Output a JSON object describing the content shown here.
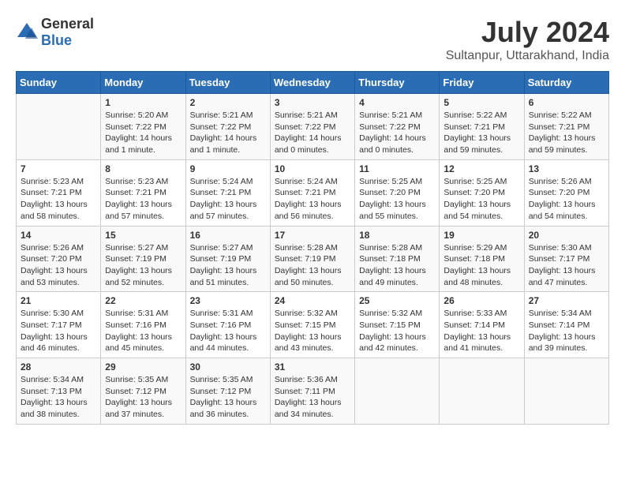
{
  "logo": {
    "general": "General",
    "blue": "Blue"
  },
  "title": "July 2024",
  "subtitle": "Sultanpur, Uttarakhand, India",
  "headers": [
    "Sunday",
    "Monday",
    "Tuesday",
    "Wednesday",
    "Thursday",
    "Friday",
    "Saturday"
  ],
  "weeks": [
    [
      {
        "date": "",
        "info": ""
      },
      {
        "date": "1",
        "info": "Sunrise: 5:20 AM\nSunset: 7:22 PM\nDaylight: 14 hours\nand 1 minute."
      },
      {
        "date": "2",
        "info": "Sunrise: 5:21 AM\nSunset: 7:22 PM\nDaylight: 14 hours\nand 1 minute."
      },
      {
        "date": "3",
        "info": "Sunrise: 5:21 AM\nSunset: 7:22 PM\nDaylight: 14 hours\nand 0 minutes."
      },
      {
        "date": "4",
        "info": "Sunrise: 5:21 AM\nSunset: 7:22 PM\nDaylight: 14 hours\nand 0 minutes."
      },
      {
        "date": "5",
        "info": "Sunrise: 5:22 AM\nSunset: 7:21 PM\nDaylight: 13 hours\nand 59 minutes."
      },
      {
        "date": "6",
        "info": "Sunrise: 5:22 AM\nSunset: 7:21 PM\nDaylight: 13 hours\nand 59 minutes."
      }
    ],
    [
      {
        "date": "7",
        "info": "Sunrise: 5:23 AM\nSunset: 7:21 PM\nDaylight: 13 hours\nand 58 minutes."
      },
      {
        "date": "8",
        "info": "Sunrise: 5:23 AM\nSunset: 7:21 PM\nDaylight: 13 hours\nand 57 minutes."
      },
      {
        "date": "9",
        "info": "Sunrise: 5:24 AM\nSunset: 7:21 PM\nDaylight: 13 hours\nand 57 minutes."
      },
      {
        "date": "10",
        "info": "Sunrise: 5:24 AM\nSunset: 7:21 PM\nDaylight: 13 hours\nand 56 minutes."
      },
      {
        "date": "11",
        "info": "Sunrise: 5:25 AM\nSunset: 7:20 PM\nDaylight: 13 hours\nand 55 minutes."
      },
      {
        "date": "12",
        "info": "Sunrise: 5:25 AM\nSunset: 7:20 PM\nDaylight: 13 hours\nand 54 minutes."
      },
      {
        "date": "13",
        "info": "Sunrise: 5:26 AM\nSunset: 7:20 PM\nDaylight: 13 hours\nand 54 minutes."
      }
    ],
    [
      {
        "date": "14",
        "info": "Sunrise: 5:26 AM\nSunset: 7:20 PM\nDaylight: 13 hours\nand 53 minutes."
      },
      {
        "date": "15",
        "info": "Sunrise: 5:27 AM\nSunset: 7:19 PM\nDaylight: 13 hours\nand 52 minutes."
      },
      {
        "date": "16",
        "info": "Sunrise: 5:27 AM\nSunset: 7:19 PM\nDaylight: 13 hours\nand 51 minutes."
      },
      {
        "date": "17",
        "info": "Sunrise: 5:28 AM\nSunset: 7:19 PM\nDaylight: 13 hours\nand 50 minutes."
      },
      {
        "date": "18",
        "info": "Sunrise: 5:28 AM\nSunset: 7:18 PM\nDaylight: 13 hours\nand 49 minutes."
      },
      {
        "date": "19",
        "info": "Sunrise: 5:29 AM\nSunset: 7:18 PM\nDaylight: 13 hours\nand 48 minutes."
      },
      {
        "date": "20",
        "info": "Sunrise: 5:30 AM\nSunset: 7:17 PM\nDaylight: 13 hours\nand 47 minutes."
      }
    ],
    [
      {
        "date": "21",
        "info": "Sunrise: 5:30 AM\nSunset: 7:17 PM\nDaylight: 13 hours\nand 46 minutes."
      },
      {
        "date": "22",
        "info": "Sunrise: 5:31 AM\nSunset: 7:16 PM\nDaylight: 13 hours\nand 45 minutes."
      },
      {
        "date": "23",
        "info": "Sunrise: 5:31 AM\nSunset: 7:16 PM\nDaylight: 13 hours\nand 44 minutes."
      },
      {
        "date": "24",
        "info": "Sunrise: 5:32 AM\nSunset: 7:15 PM\nDaylight: 13 hours\nand 43 minutes."
      },
      {
        "date": "25",
        "info": "Sunrise: 5:32 AM\nSunset: 7:15 PM\nDaylight: 13 hours\nand 42 minutes."
      },
      {
        "date": "26",
        "info": "Sunrise: 5:33 AM\nSunset: 7:14 PM\nDaylight: 13 hours\nand 41 minutes."
      },
      {
        "date": "27",
        "info": "Sunrise: 5:34 AM\nSunset: 7:14 PM\nDaylight: 13 hours\nand 39 minutes."
      }
    ],
    [
      {
        "date": "28",
        "info": "Sunrise: 5:34 AM\nSunset: 7:13 PM\nDaylight: 13 hours\nand 38 minutes."
      },
      {
        "date": "29",
        "info": "Sunrise: 5:35 AM\nSunset: 7:12 PM\nDaylight: 13 hours\nand 37 minutes."
      },
      {
        "date": "30",
        "info": "Sunrise: 5:35 AM\nSunset: 7:12 PM\nDaylight: 13 hours\nand 36 minutes."
      },
      {
        "date": "31",
        "info": "Sunrise: 5:36 AM\nSunset: 7:11 PM\nDaylight: 13 hours\nand 34 minutes."
      },
      {
        "date": "",
        "info": ""
      },
      {
        "date": "",
        "info": ""
      },
      {
        "date": "",
        "info": ""
      }
    ]
  ]
}
